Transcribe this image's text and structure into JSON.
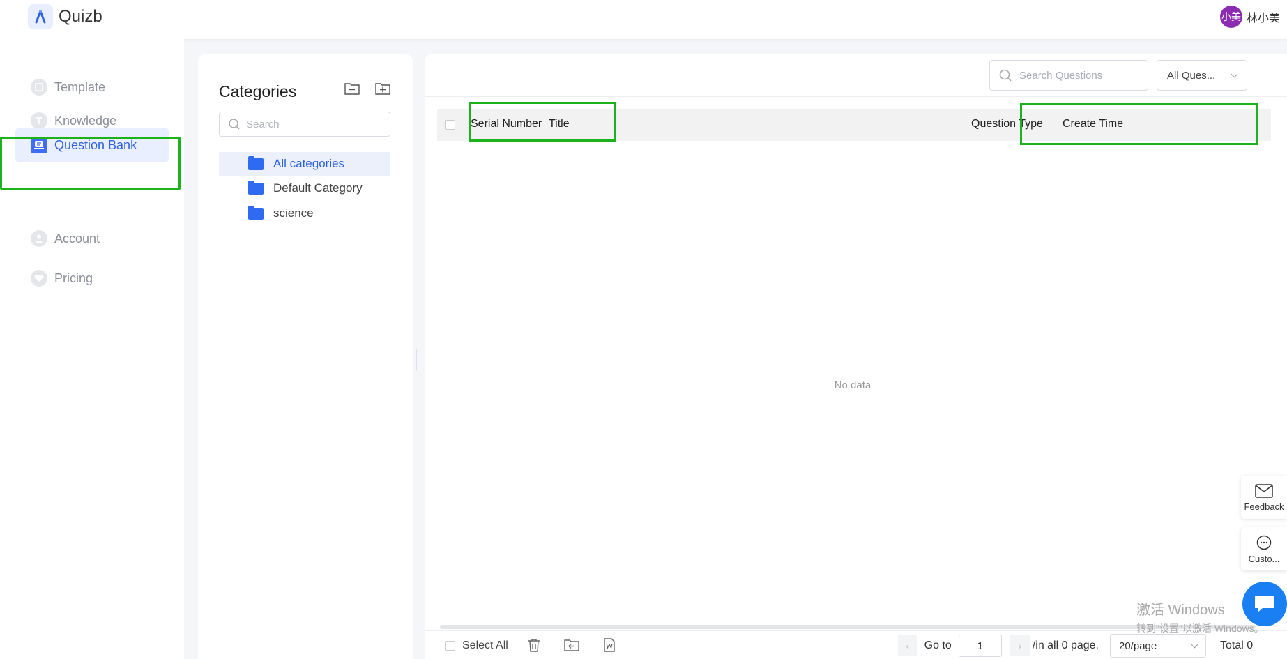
{
  "app": {
    "title": "Quizb"
  },
  "user": {
    "avatar_text": "小美",
    "name": "林小美"
  },
  "sidebar": {
    "items": [
      {
        "label": "Template"
      },
      {
        "label": "Knowledge"
      },
      {
        "label": "Question Bank",
        "active": true
      },
      {
        "label": "Account"
      },
      {
        "label": "Pricing"
      }
    ]
  },
  "categories": {
    "title": "Categories",
    "search_placeholder": "Search",
    "items": [
      {
        "label": "All categories",
        "active": true
      },
      {
        "label": "Default Category"
      },
      {
        "label": "science"
      }
    ]
  },
  "questions": {
    "search_placeholder": "Search Questions",
    "filter_value": "All Ques...",
    "columns": [
      "Serial Number",
      "Title",
      "Question Type",
      "Create Time"
    ],
    "empty_text": "No data"
  },
  "footer": {
    "select_all_label": "Select All",
    "goto_label": "Go to",
    "page_value": "1",
    "of_text": "/in all 0 page,",
    "page_size": "20/page",
    "total_text": "Total 0"
  },
  "float_tools": {
    "feedback_label": "Feedback",
    "customer_label": "Custo..."
  },
  "watermark": {
    "line1": "激活 Windows",
    "line2": "转到\"设置\"以激活 Windows。"
  },
  "colors": {
    "accent": "#2e62e6",
    "highlight": "#1bb21b",
    "avatar": "#8a2bb0"
  }
}
